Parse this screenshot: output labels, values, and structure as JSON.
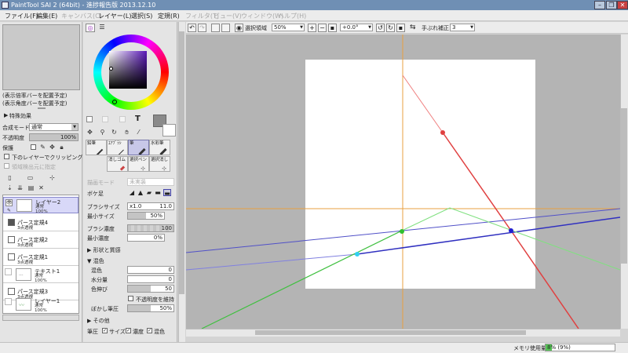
{
  "window": {
    "title": "PaintTool SAI 2 (64bit) - 進捗報告版 2013.12.10"
  },
  "menu": {
    "items": [
      {
        "label": "ファイル(F)",
        "enabled": true
      },
      {
        "label": "編集(E)",
        "enabled": true
      },
      {
        "label": "キャンバス(C)",
        "enabled": false
      },
      {
        "label": "レイヤー(L)",
        "enabled": true
      },
      {
        "label": "選択(S)",
        "enabled": true
      },
      {
        "label": "定規(R)",
        "enabled": true
      },
      {
        "label": "フィルタ(T)",
        "enabled": false
      },
      {
        "label": "ビュー(V)",
        "enabled": false
      },
      {
        "label": "ウィンドウ(W)",
        "enabled": false
      },
      {
        "label": "ヘルプ(H)",
        "enabled": false
      }
    ]
  },
  "left_panel": {
    "zoom_note": "(表示倍率バーを配置予定)",
    "angle_note": "(表示角度バーを配置予定)",
    "effects_label": "特殊効果",
    "blend_mode_label": "合成モード",
    "blend_mode_value": "通常",
    "opacity_label": "不透明度",
    "opacity_value": "100%",
    "opacity_fraction": 1.0,
    "protect_label": "保護",
    "clip_label": "下のレイヤーでクリッピング",
    "select_source_label": "領域検出元に指定",
    "layers": [
      {
        "name": "レイヤー2",
        "mode": "通常",
        "opacity": "100%",
        "kind": "layer",
        "selected": true
      },
      {
        "name": "パース定規4",
        "mode": "3点透視",
        "kind": "ruler"
      },
      {
        "name": "パース定規2",
        "mode": "3点透視",
        "kind": "ruler"
      },
      {
        "name": "パース定規1",
        "mode": "3点透視",
        "kind": "ruler"
      },
      {
        "name": "テキスト1",
        "mode": "通常",
        "opacity": "100%",
        "kind": "text"
      },
      {
        "name": "パース定規3",
        "mode": "3点透視",
        "kind": "ruler"
      },
      {
        "name": "レイヤー1",
        "mode": "通常",
        "opacity": "100%",
        "kind": "layer"
      }
    ]
  },
  "tool_panel": {
    "text_tool_glyph": "T",
    "tools": [
      {
        "label": "鉛筆"
      },
      {
        "label": "ｴｱﾌﾞﾗｼ"
      },
      {
        "label": "筆",
        "selected": true
      },
      {
        "label": "水彩筆"
      },
      {
        "label": "消しゴム"
      },
      {
        "label": "選択ペン"
      },
      {
        "label": "選択消し"
      }
    ],
    "drawing_mode_label": "描画モード",
    "drawing_mode_value": "未実装",
    "blur_label": "ボケ足",
    "brush_size_label": "ブラシサイズ",
    "brush_size_mult": "x1.0",
    "brush_size_value": "11.0",
    "min_size_label": "最小サイズ",
    "min_size_value": "50%",
    "min_size_fraction": 0.5,
    "density_label": "ブラシ濃度",
    "density_value": "100",
    "density_fraction": 1.0,
    "min_density_label": "最小濃度",
    "min_density_value": "0%",
    "min_density_fraction": 0.0,
    "shape_texture_label": "形状と質感",
    "mixing_label": "混色",
    "mix_color_label": "混色",
    "mix_color_value": "0",
    "water_label": "水分量",
    "water_value": "0",
    "stretch_label": "色伸び",
    "stretch_value": "50",
    "stretch_fraction": 0.5,
    "keep_opacity_label": "不透明度を維持",
    "blur_pressure_label": "ぼかし筆圧",
    "blur_pressure_value": "50%",
    "blur_pressure_fraction": 0.5,
    "other_label": "その他",
    "pressure_label": "筆圧",
    "pressure_size_label": "サイズ",
    "pressure_density_label": "濃度",
    "pressure_mix_label": "混色",
    "main_color": "#8a8a8a",
    "wheel_color": "#5a19b8"
  },
  "canvas_toolbar": {
    "selection_label": "選択領域",
    "zoom_value": "50%",
    "angle_value": "+0.0°",
    "stabilizer_label": "手ぶれ補正",
    "stabilizer_value": "3"
  },
  "status": {
    "memory_label": "メモリ使用量",
    "memory_value": "8% (9%)",
    "memory_fraction": 0.09
  },
  "colors": {
    "orange_guide": "#e8a040",
    "red_line": "#e04040",
    "green_line": "#40c040",
    "blue_line": "#3030c0"
  }
}
